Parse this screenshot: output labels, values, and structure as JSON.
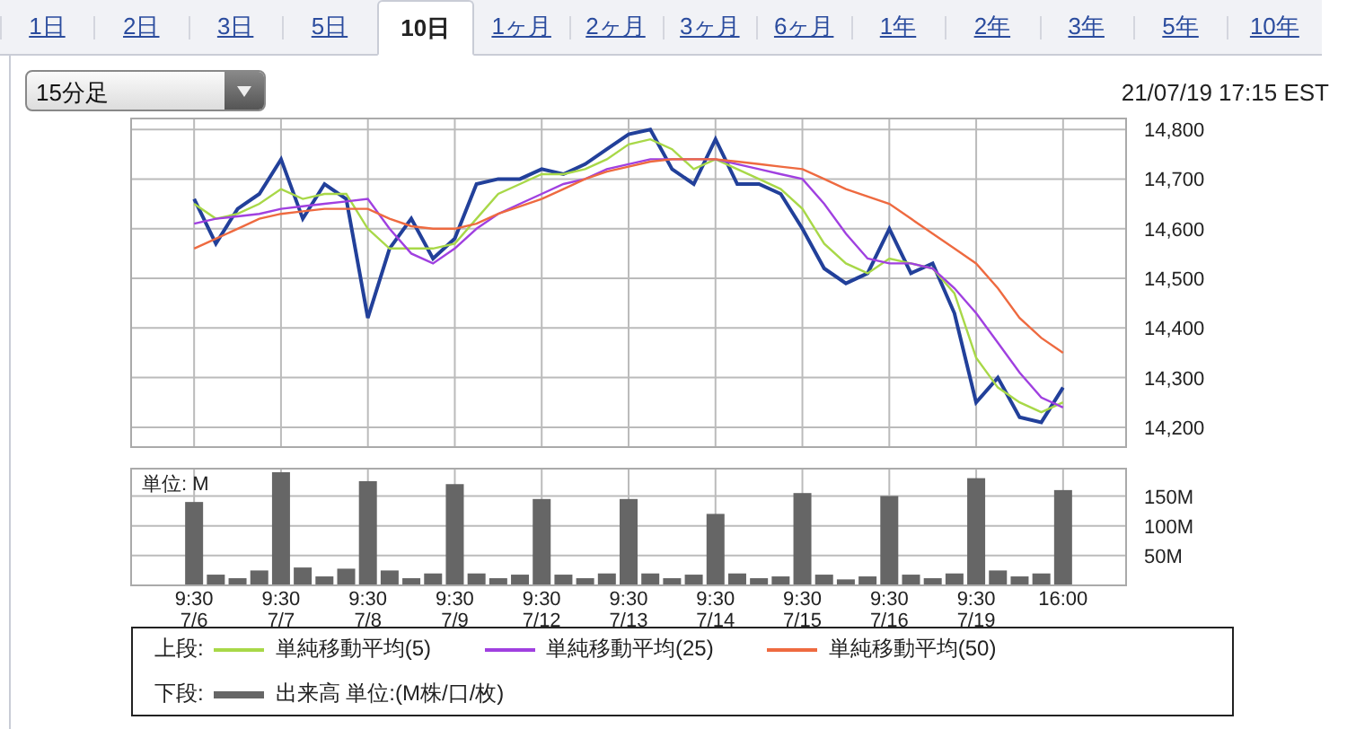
{
  "tabs": [
    {
      "label": "1日",
      "selected": false
    },
    {
      "label": "2日",
      "selected": false
    },
    {
      "label": "3日",
      "selected": false
    },
    {
      "label": "5日",
      "selected": false
    },
    {
      "label": "10日",
      "selected": true
    },
    {
      "label": "1ヶ月",
      "selected": false
    },
    {
      "label": "2ヶ月",
      "selected": false
    },
    {
      "label": "3ヶ月",
      "selected": false
    },
    {
      "label": "6ヶ月",
      "selected": false
    },
    {
      "label": "1年",
      "selected": false
    },
    {
      "label": "2年",
      "selected": false
    },
    {
      "label": "3年",
      "selected": false
    },
    {
      "label": "5年",
      "selected": false
    },
    {
      "label": "10年",
      "selected": false
    }
  ],
  "interval_dropdown": {
    "value": "15分足"
  },
  "timestamp": "21/07/19 17:15 EST",
  "price_chart": {
    "legend_label": "上段:",
    "chart_data": {
      "type": "line",
      "grid": true,
      "ylim": [
        14160,
        14822
      ],
      "yticks": [
        {
          "value": 14200,
          "label": "14,200"
        },
        {
          "value": 14300,
          "label": "14,300"
        },
        {
          "value": 14400,
          "label": "14,400"
        },
        {
          "value": 14500,
          "label": "14,500"
        },
        {
          "value": 14600,
          "label": "14,600"
        },
        {
          "value": 14700,
          "label": "14,700"
        },
        {
          "value": 14800,
          "label": "14,800"
        }
      ],
      "series": [
        {
          "color": "#22409a",
          "values": [
            14660,
            14570,
            14640,
            14670,
            14740,
            14620,
            14690,
            14660,
            14420,
            14560,
            14620,
            14540,
            14580,
            14690,
            14700,
            14700,
            14720,
            14710,
            14730,
            14760,
            14790,
            14800,
            14720,
            14690,
            14780,
            14690,
            14690,
            14670,
            14600,
            14520,
            14490,
            14510,
            14600,
            14510,
            14530,
            14430,
            14250,
            14300,
            14220,
            14210,
            14280
          ]
        },
        {
          "name": "単純移動平均(5)",
          "color": "#a8d848",
          "values": [
            14650,
            14620,
            14630,
            14650,
            14680,
            14660,
            14670,
            14670,
            14600,
            14560,
            14560,
            14560,
            14570,
            14620,
            14670,
            14690,
            14710,
            14710,
            14720,
            14740,
            14770,
            14780,
            14760,
            14720,
            14740,
            14720,
            14700,
            14680,
            14640,
            14570,
            14530,
            14510,
            14540,
            14530,
            14520,
            14470,
            14340,
            14280,
            14250,
            14230,
            14250
          ]
        },
        {
          "name": "単純移動平均(25)",
          "color": "#a040e0",
          "values": [
            14610,
            14620,
            14625,
            14630,
            14640,
            14645,
            14650,
            14655,
            14660,
            14600,
            14550,
            14530,
            14560,
            14600,
            14630,
            14650,
            14670,
            14690,
            14700,
            14720,
            14730,
            14740,
            14740,
            14740,
            14740,
            14730,
            14720,
            14710,
            14700,
            14650,
            14590,
            14540,
            14530,
            14530,
            14520,
            14480,
            14430,
            14370,
            14310,
            14260,
            14240
          ]
        },
        {
          "name": "単純移動平均(50)",
          "color": "#ee6a40",
          "values": [
            14560,
            14580,
            14600,
            14620,
            14630,
            14635,
            14640,
            14640,
            14640,
            14620,
            14605,
            14600,
            14600,
            14610,
            14630,
            14645,
            14660,
            14680,
            14700,
            14715,
            14725,
            14735,
            14740,
            14740,
            14740,
            14735,
            14730,
            14725,
            14720,
            14700,
            14680,
            14665,
            14650,
            14620,
            14590,
            14560,
            14530,
            14480,
            14420,
            14380,
            14350
          ]
        }
      ]
    }
  },
  "volume_chart": {
    "unit_label": "単位: M",
    "legend_label": "下段:",
    "chart_data": {
      "type": "bar",
      "grid": true,
      "ylim": [
        0,
        196
      ],
      "yticks": [
        {
          "value": 50,
          "label": "50M"
        },
        {
          "value": 100,
          "label": "100M"
        },
        {
          "value": 150,
          "label": "150M"
        }
      ],
      "categories": [
        "9:30 7/6",
        null,
        null,
        null,
        "9:30 7/7",
        null,
        null,
        null,
        "9:30 7/8",
        null,
        null,
        null,
        "9:30 7/9",
        null,
        null,
        null,
        "9:30 7/12",
        null,
        null,
        null,
        "9:30 7/13",
        null,
        null,
        null,
        "9:30 7/14",
        null,
        null,
        null,
        "9:30 7/15",
        null,
        null,
        null,
        "9:30 7/16",
        null,
        null,
        null,
        "9:30 7/19",
        null,
        null,
        null,
        "16:00"
      ],
      "series": [
        {
          "name": "出来高 単位:(M株/口/枚)",
          "color": "#666666",
          "values": [
            140,
            18,
            12,
            25,
            190,
            30,
            15,
            28,
            175,
            25,
            12,
            20,
            170,
            20,
            12,
            18,
            145,
            18,
            12,
            20,
            145,
            20,
            12,
            18,
            120,
            20,
            12,
            15,
            155,
            18,
            10,
            15,
            150,
            18,
            12,
            20,
            180,
            25,
            15,
            20,
            160
          ]
        }
      ]
    }
  }
}
